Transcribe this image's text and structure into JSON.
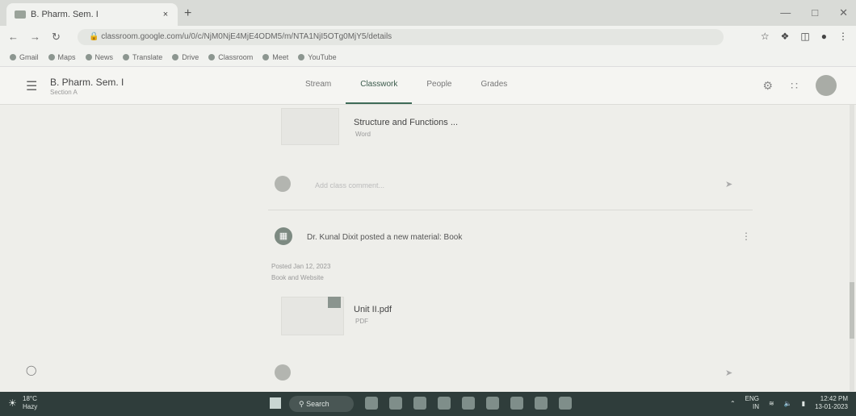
{
  "browser": {
    "tab_title": "B. Pharm. Sem. I",
    "tab_close": "×",
    "new_tab": "+",
    "url": "classroom.google.com/u/0/c/NjM0NjE4MjE4ODM5/m/NTA1NjI5OTg0MjY5/details",
    "bookmarks": [
      "Gmail",
      "Maps",
      "News",
      "Translate",
      "Drive",
      "Classroom",
      "Meet",
      "YouTube"
    ]
  },
  "classroom": {
    "class_name": "B. Pharm. Sem. I",
    "class_section": "Section A",
    "tabs": [
      "Stream",
      "Classwork",
      "People",
      "Grades"
    ],
    "active_tab": "Classwork"
  },
  "posts": {
    "first_material_title": "Structure and Functions ...",
    "first_material_sub": "Word",
    "comment_placeholder": "Add class comment...",
    "second_post_text": "Dr. Kunal Dixit posted a new material: Book",
    "second_post_date": "Posted Jan 12, 2023",
    "second_post_desc": "Book and Website",
    "attachment_title": "Unit II.pdf",
    "attachment_sub": "PDF"
  },
  "taskbar": {
    "weather_temp": "18°C",
    "weather_desc": "Hazy",
    "search_label": "Search",
    "lang": "ENG",
    "lang_region": "IN",
    "time": "12:42 PM",
    "date": "13-01-2023"
  }
}
